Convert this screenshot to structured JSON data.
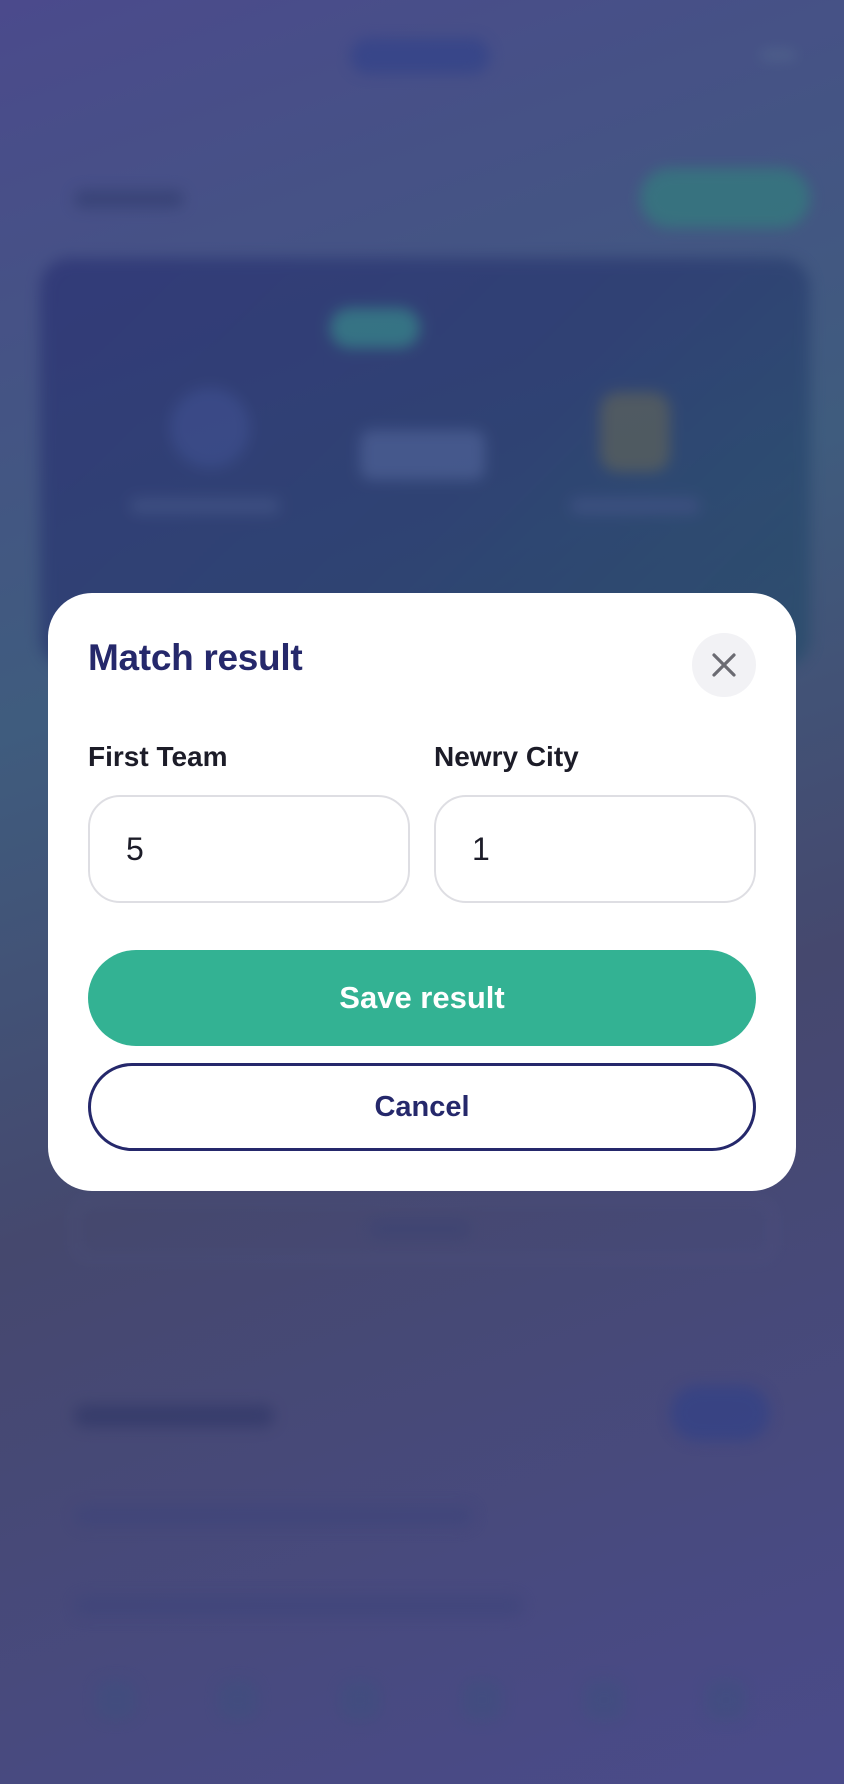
{
  "modal": {
    "title": "Match result",
    "close_icon": "close-icon",
    "home_team_label": "First Team",
    "away_team_label": "Newry City",
    "home_score": "5",
    "away_score": "1",
    "save_label": "Save result",
    "cancel_label": "Cancel"
  },
  "colors": {
    "primary_navy": "#25286b",
    "accent_green": "#33b293",
    "overlay_tint": "#4b4a8c"
  }
}
